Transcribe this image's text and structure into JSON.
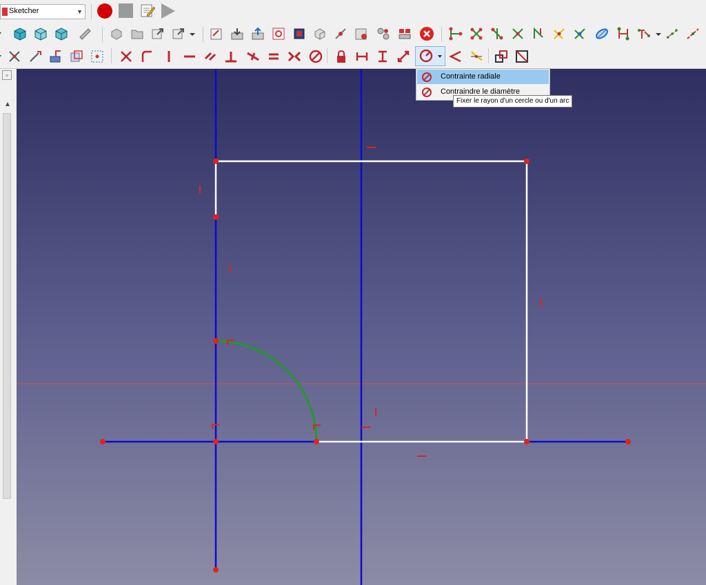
{
  "workbench_selector": {
    "value": "Sketcher",
    "icon": "sketcher-logo-icon"
  },
  "macro_toolbar": {
    "record": "macro-record-icon",
    "stop": "macro-stop-icon",
    "edit": "macro-edit-icon",
    "run": "macro-run-icon"
  },
  "constraint_dropdown": {
    "items": [
      {
        "label": "Contrainte radiale",
        "icon": "radius-constraint-icon",
        "highlighted": true
      },
      {
        "label": "Contraindre le diamètre",
        "icon": "diameter-constraint-icon",
        "highlighted": false
      }
    ],
    "tooltip": "Fixer le rayon d'un cercle ou d'un arc"
  },
  "colors": {
    "toolbar_bg": "#f0f0f0",
    "canvas_top": "#2e2f60",
    "canvas_bottom": "#8d8ca6",
    "construction_line": "#0a0ad0",
    "geometry_line": "#ffffff",
    "arc_line": "#1aa01a",
    "vertex": "#e8201a",
    "menu_highlight": "#99c9ef",
    "constraint_icon_red": "#c1272d"
  }
}
